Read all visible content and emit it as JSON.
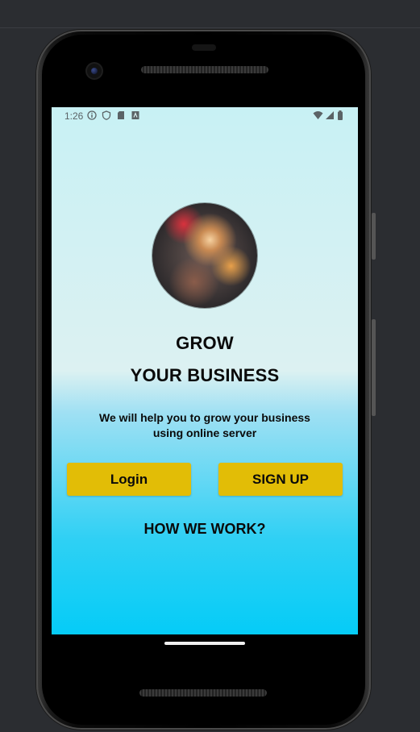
{
  "status_bar": {
    "time": "1:26",
    "left_icons": [
      "info-icon",
      "shield-icon",
      "sd-card-icon",
      "app-icon"
    ],
    "right_icons": [
      "wifi-icon",
      "signal-icon",
      "battery-icon"
    ]
  },
  "hero": {
    "title_line1": "GROW",
    "title_line2": "YOUR BUSINESS",
    "description": "We will help you to grow your business using online server"
  },
  "actions": {
    "login_label": "Login",
    "signup_label": "SIGN UP",
    "how_label": "HOW WE WORK?"
  },
  "colors": {
    "button_bg": "#e2bd06",
    "screen_top": "#c8f1f4",
    "screen_bottom": "#05ccf7"
  }
}
